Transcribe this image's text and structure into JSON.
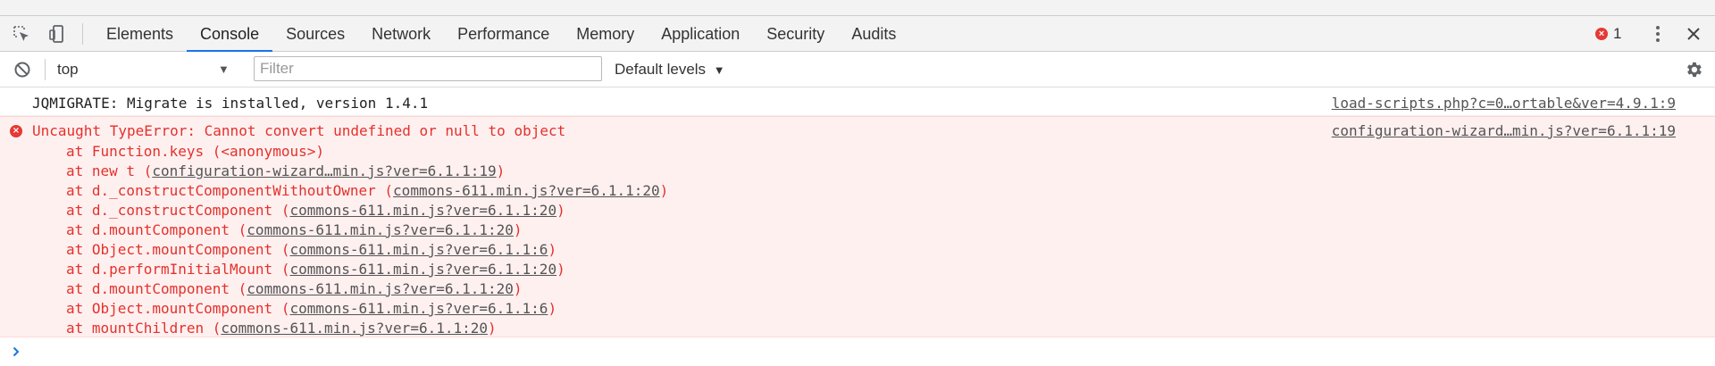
{
  "tabs": [
    {
      "label": "Elements",
      "active": false
    },
    {
      "label": "Console",
      "active": true
    },
    {
      "label": "Sources",
      "active": false
    },
    {
      "label": "Network",
      "active": false
    },
    {
      "label": "Performance",
      "active": false
    },
    {
      "label": "Memory",
      "active": false
    },
    {
      "label": "Application",
      "active": false
    },
    {
      "label": "Security",
      "active": false
    },
    {
      "label": "Audits",
      "active": false
    }
  ],
  "header": {
    "error_count": "1",
    "error_icon": "error-circle-icon",
    "icons": [
      "inspect-element-icon",
      "device-toolbar-icon",
      "more-menu-icon",
      "close-icon"
    ]
  },
  "toolbar": {
    "context": "top",
    "filter_placeholder": "Filter",
    "filter_value": "",
    "levels_label": "Default levels",
    "icons": [
      "clear-console-icon",
      "settings-gear-icon"
    ]
  },
  "messages": {
    "log": {
      "text": "JQMIGRATE: Migrate is installed, version 1.4.1",
      "source": "load-scripts.php?c=0…ortable&ver=4.9.1:9"
    },
    "error": {
      "headline": "Uncaught TypeError: Cannot convert undefined or null to object",
      "source": "configuration-wizard…min.js?ver=6.1.1:19",
      "stack": [
        {
          "fn": "at Function.keys (",
          "link": "",
          "plain": "<anonymous>",
          "close": ")"
        },
        {
          "fn": "at new t (",
          "link": "configuration-wizard…min.js?ver=6.1.1:19",
          "plain": "",
          "close": ")"
        },
        {
          "fn": "at d._constructComponentWithoutOwner (",
          "link": "commons-611.min.js?ver=6.1.1:20",
          "plain": "",
          "close": ")"
        },
        {
          "fn": "at d._constructComponent (",
          "link": "commons-611.min.js?ver=6.1.1:20",
          "plain": "",
          "close": ")"
        },
        {
          "fn": "at d.mountComponent (",
          "link": "commons-611.min.js?ver=6.1.1:20",
          "plain": "",
          "close": ")"
        },
        {
          "fn": "at Object.mountComponent (",
          "link": "commons-611.min.js?ver=6.1.1:6",
          "plain": "",
          "close": ")"
        },
        {
          "fn": "at d.performInitialMount (",
          "link": "commons-611.min.js?ver=6.1.1:20",
          "plain": "",
          "close": ")"
        },
        {
          "fn": "at d.mountComponent (",
          "link": "commons-611.min.js?ver=6.1.1:20",
          "plain": "",
          "close": ")"
        },
        {
          "fn": "at Object.mountComponent (",
          "link": "commons-611.min.js?ver=6.1.1:6",
          "plain": "",
          "close": ")"
        },
        {
          "fn": "at mountChildren (",
          "link": "commons-611.min.js?ver=6.1.1:20",
          "plain": "",
          "close": ")"
        }
      ]
    }
  },
  "prompt": {
    "icon": "prompt-chevron-icon"
  },
  "colors": {
    "accent": "#1a73e8",
    "error_text": "#e4312b",
    "error_bg": "#fff0f0",
    "error_badge": "#e53935"
  }
}
